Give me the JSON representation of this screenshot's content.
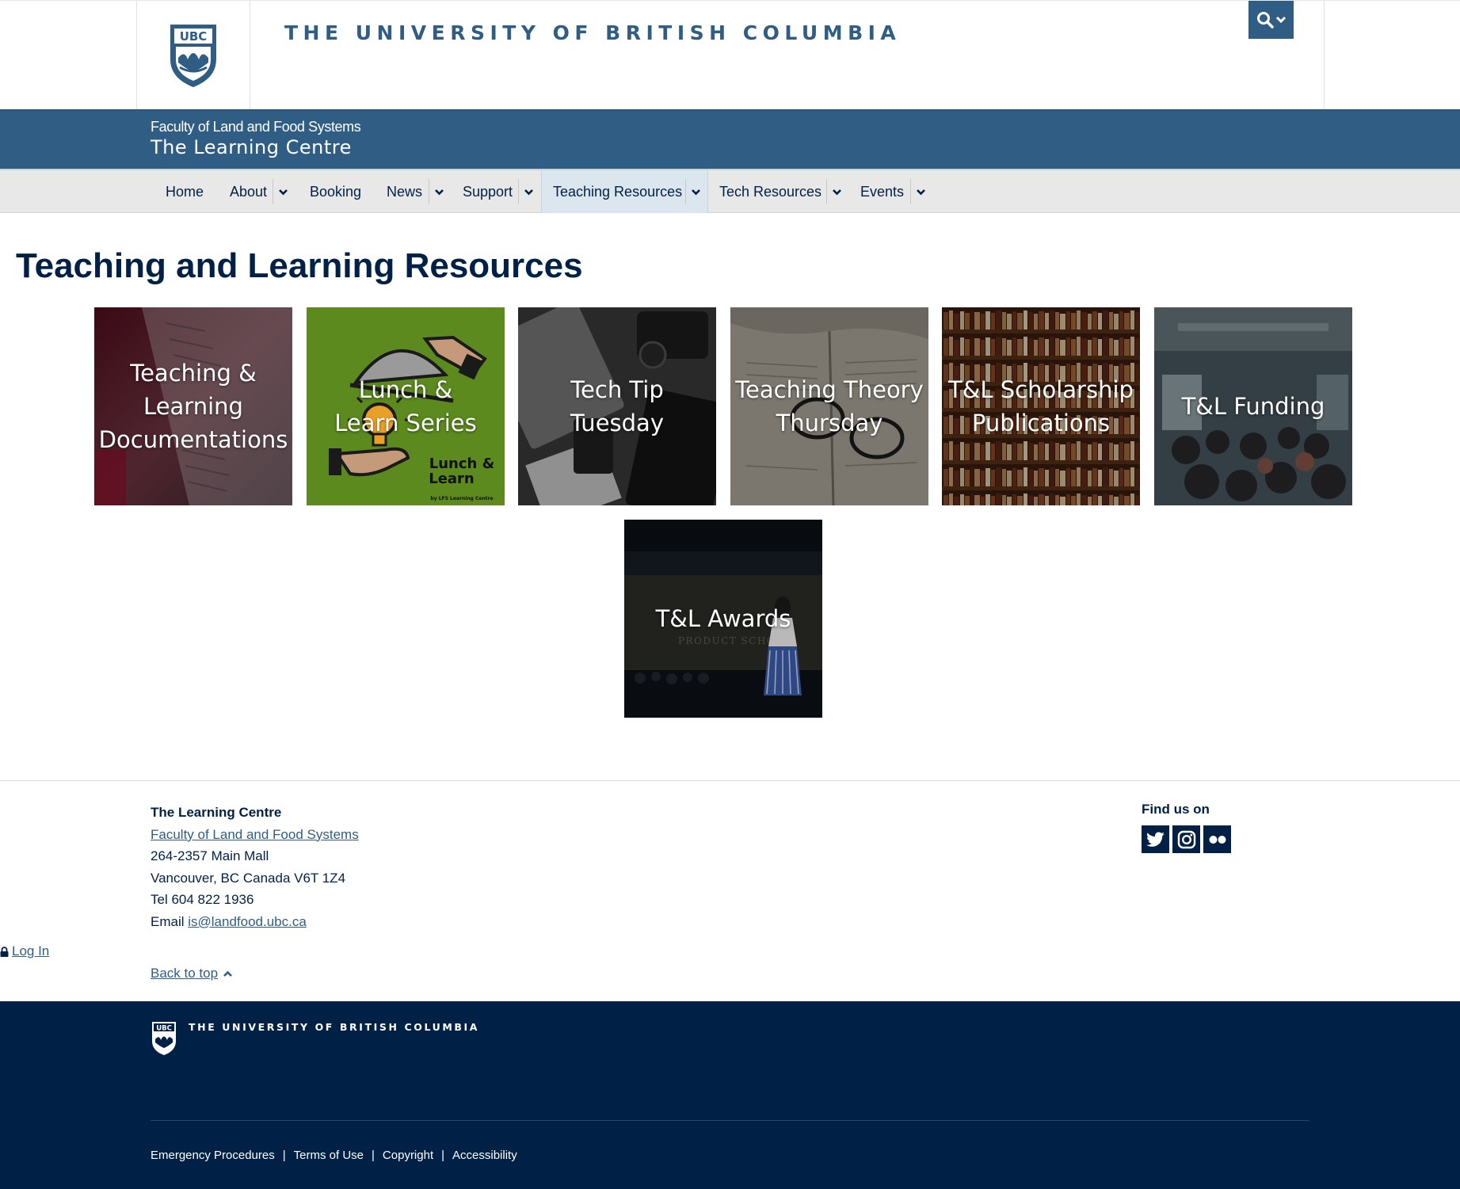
{
  "brand": {
    "logo_text": "UBC",
    "wordmark": "THE UNIVERSITY OF BRITISH COLUMBIA",
    "search_icon": "search-icon",
    "search_caret_icon": "chevron-down-icon"
  },
  "unit": {
    "faculty": "Faculty of Land and Food Systems",
    "name": "The Learning Centre"
  },
  "nav": {
    "items": [
      {
        "label": "Home",
        "has_dropdown": false
      },
      {
        "label": "About",
        "has_dropdown": true
      },
      {
        "label": "Booking",
        "has_dropdown": false
      },
      {
        "label": "News",
        "has_dropdown": true
      },
      {
        "label": "Support",
        "has_dropdown": true
      },
      {
        "label": "Teaching Resources",
        "has_dropdown": true,
        "active": true
      },
      {
        "label": "Tech Resources",
        "has_dropdown": true
      },
      {
        "label": "Events",
        "has_dropdown": true
      }
    ]
  },
  "main": {
    "title": "Teaching and Learning Resources",
    "tiles": [
      {
        "label": "Teaching & Learning Documentations"
      },
      {
        "label": "Lunch & Learn Series",
        "image_text": "Lunch & Learn",
        "image_subtext": "by LFS Learning Centre"
      },
      {
        "label": "Tech Tip Tuesday"
      },
      {
        "label": "Teaching Theory Thursday"
      },
      {
        "label": "T&L Scholarship Publications"
      },
      {
        "label": "T&L Funding"
      },
      {
        "label": "T&L Awards"
      }
    ]
  },
  "contact": {
    "heading": "The Learning Centre",
    "faculty_link": "Faculty of Land and Food Systems",
    "address1": "264-2357 Main Mall",
    "address2": "Vancouver, BC Canada V6T 1Z4",
    "tel": "Tel 604 822 1936",
    "email_label": "Email ",
    "email": "is@landfood.ubc.ca"
  },
  "social": {
    "heading": "Find us on",
    "icons": [
      "twitter-icon",
      "instagram-icon",
      "flickr-icon"
    ]
  },
  "login": {
    "label": "Log In"
  },
  "back_to_top": {
    "label": "Back to top"
  },
  "global_footer": {
    "logo_text": "UBC",
    "wordmark": "THE UNIVERSITY OF BRITISH COLUMBIA",
    "links": [
      "Emergency Procedures",
      "Terms of Use",
      "Copyright",
      "Accessibility"
    ]
  },
  "colors": {
    "ubc_navy": "#002145",
    "unit_blue": "#2f5d84",
    "nav_bg": "#e8e8e8",
    "lunch_green": "#5c8a1e"
  }
}
